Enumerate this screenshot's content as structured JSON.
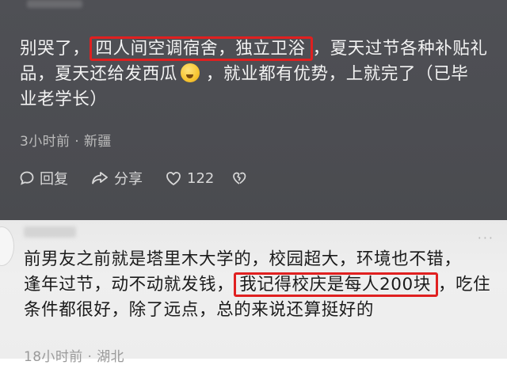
{
  "comments": [
    {
      "lines_before": [
        "别哭了，"
      ],
      "highlight_1": "四人间空调宿舍，独立卫浴",
      "line1_after": "，夏天过节各种补贴礼",
      "line2_before": "品，夏天还给发西瓜",
      "line2_after": "，就业都有优势，上就完了（已毕",
      "line3": "业老学长）",
      "time": "3小时前",
      "separator": "·",
      "location": "新疆",
      "reply_label": "回复",
      "share_label": "分享",
      "like_count": "122",
      "emoji": "grimacing-face-emoji"
    },
    {
      "line1": "前男友之前就是塔里木大学的，校园超大，环境也不错，",
      "line2_before": "逢年过节，动不动就发钱，",
      "highlight": "我记得校庆是每人200块",
      "line2_after": "，吃住",
      "line3": "条件都很好，除了远点，总的来说还算挺好的",
      "time": "18小时前",
      "separator": "·",
      "location": "湖北",
      "more": "···"
    }
  ],
  "colors": {
    "top_bg": "#4f5055",
    "bottom_bg": "#ededed",
    "highlight_border": "#e02020"
  }
}
